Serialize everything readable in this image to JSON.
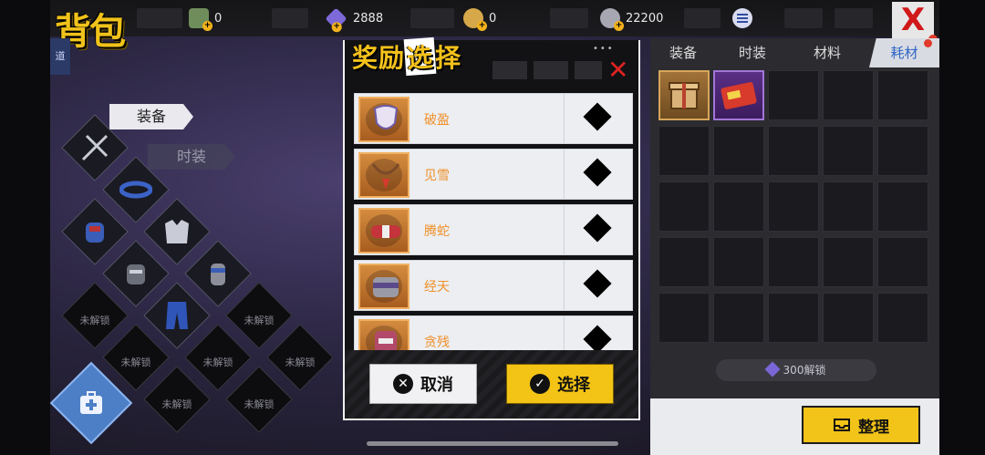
{
  "header": {
    "title": "背包",
    "currencies": [
      {
        "icon": "cash-icon",
        "value": "0"
      },
      {
        "icon": "crystal-icon",
        "value": "2888"
      },
      {
        "icon": "coin-icon",
        "value": "0"
      },
      {
        "icon": "silver-coin-icon",
        "value": "22200"
      }
    ],
    "close_label": "X"
  },
  "left": {
    "side_tab": "道",
    "categories": [
      "装备",
      "时装"
    ],
    "locked_label": "未解锁",
    "slot_icons": [
      "weapon-icon",
      "headband-icon",
      "gloves-icon",
      "jacket-icon",
      "glove-icon",
      "gauntlet-icon",
      "pants-icon"
    ]
  },
  "right": {
    "tabs": [
      "装备",
      "时装",
      "材料",
      "耗材"
    ],
    "active_tab": 3,
    "items": [
      {
        "icon": "gift-box-icon",
        "rarity": "gold"
      },
      {
        "icon": "ticket-card-icon",
        "rarity": "purple"
      }
    ],
    "unlock_label": "300解锁",
    "sort_label": "整理"
  },
  "modal": {
    "title_parts": [
      "奖励",
      "选",
      "择"
    ],
    "close_label": "✕",
    "options": [
      {
        "name": "破盈",
        "icon": "bib-icon"
      },
      {
        "name": "见雪",
        "icon": "pendant-icon"
      },
      {
        "name": "腾蛇",
        "icon": "belt-icon"
      },
      {
        "name": "经天",
        "icon": "bracer-icon"
      },
      {
        "name": "贪残",
        "icon": "cuff-icon"
      }
    ],
    "cancel_label": "取消",
    "confirm_label": "选择",
    "colors": {
      "accent": "#f3c316",
      "option_name": "#f0902a"
    }
  }
}
